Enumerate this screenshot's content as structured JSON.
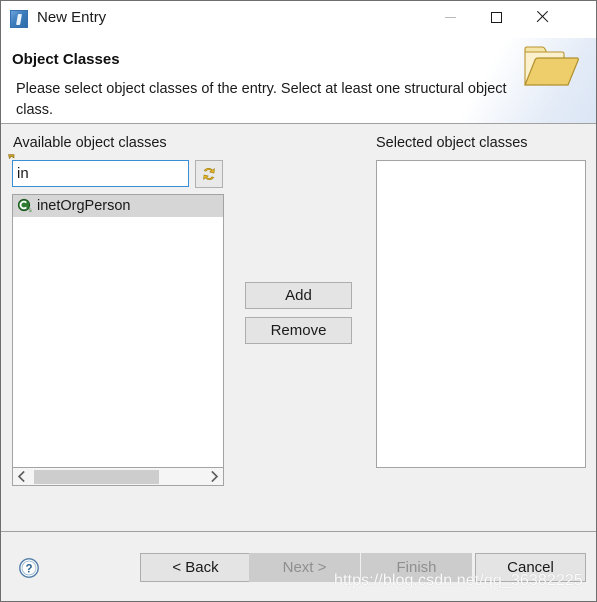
{
  "window": {
    "title": "New Entry",
    "app_icon": "apache-directory-studio-icon",
    "controls": {
      "minimize": {
        "label": "Minimize",
        "icon": "minimize-icon",
        "enabled": false
      },
      "maximize": {
        "label": "Maximize",
        "icon": "maximize-icon",
        "enabled": true
      },
      "close": {
        "label": "Close",
        "icon": "close-icon",
        "enabled": true
      }
    }
  },
  "header": {
    "title": "Object Classes",
    "description": "Please select object classes of the entry. Select at least one structural object class.",
    "icon": "folder-icon"
  },
  "available": {
    "label": "Available object classes",
    "filter": {
      "value": "in",
      "placeholder": "",
      "button_icon": "refresh-icon",
      "button_label": "Refresh"
    },
    "items": [
      {
        "label": "inetOrgPerson",
        "icon": "object-class-structural-icon",
        "selected": true
      }
    ],
    "scrollbar": {
      "left_arrow_icon": "chevron-left-icon",
      "right_arrow_icon": "chevron-right-icon"
    }
  },
  "selected": {
    "label": "Selected object classes",
    "items": []
  },
  "transfer_buttons": {
    "add_label": "Add",
    "remove_label": "Remove"
  },
  "footer": {
    "help_icon": "help-icon",
    "buttons": [
      {
        "name": "back",
        "label": "< Back",
        "enabled": true
      },
      {
        "name": "next",
        "label": "Next >",
        "enabled": false
      },
      {
        "name": "finish",
        "label": "Finish",
        "enabled": false
      },
      {
        "name": "cancel",
        "label": "Cancel",
        "enabled": true
      }
    ]
  },
  "watermark": "https://blog.csdn.net/qq_36382225",
  "colors": {
    "accent_focus": "#3a8fd4",
    "window_bg": "#f0f0f0",
    "header_bg": "#ffffff",
    "selection": "#d6d6d6",
    "disabled_text": "#8f8f8f",
    "folder": "#e8c65a"
  }
}
